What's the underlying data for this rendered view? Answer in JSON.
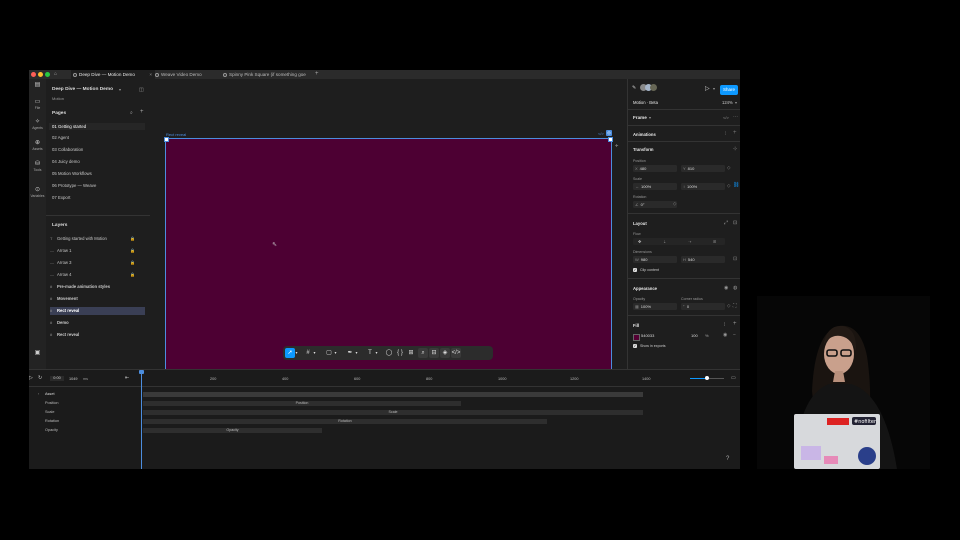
{
  "tabs": [
    {
      "label": "Deep Dive — Motion Demo",
      "active": true
    },
    {
      "label": "Weave Video Demo",
      "active": false
    },
    {
      "label": "Spinny Pink Square (if something goe",
      "active": false
    }
  ],
  "new_tab_symbol": "+",
  "file": {
    "name": "Deep Dive — Motion Demo",
    "subtitle": "Motion"
  },
  "rail": [
    {
      "icon": "file-icon",
      "label": "File"
    },
    {
      "icon": "agents-icon",
      "label": "Agents"
    },
    {
      "icon": "assets-icon",
      "label": "Assets"
    },
    {
      "icon": "tools-icon",
      "label": "Tools"
    },
    {
      "icon": "variables-icon",
      "label": "Variables"
    }
  ],
  "pages": {
    "title": "Pages",
    "items": [
      "01 Getting started",
      "02 Agent",
      "03 Collaboration",
      "04 Juicy demo",
      "05 Motion Workflows",
      "06 Prototype — Weave",
      "07 Export"
    ],
    "selected_index": 0
  },
  "layers": {
    "title": "Layers",
    "items": [
      {
        "label": "Getting started with Motion",
        "locked": true,
        "bold": false
      },
      {
        "label": "Arrow 1",
        "locked": true,
        "bold": false
      },
      {
        "label": "Arrow 3",
        "locked": true,
        "bold": false
      },
      {
        "label": "Arrow 4",
        "locked": true,
        "bold": false
      },
      {
        "label": "Pre-made animation styles",
        "locked": false,
        "bold": true
      },
      {
        "label": "Movement",
        "locked": false,
        "bold": true
      },
      {
        "label": "Rect reveal",
        "locked": false,
        "bold": true
      },
      {
        "label": "Demo",
        "locked": false,
        "bold": true
      },
      {
        "label": "Rect reveal",
        "locked": false,
        "bold": true
      }
    ],
    "selected_index": 6
  },
  "canvas": {
    "frame_label": "Rect reveal",
    "frame_color": "#4d0033"
  },
  "right": {
    "mode": "Motion · Beta",
    "zoom": "124%",
    "share": "Share",
    "frame_label": "Frame",
    "animations": "Animations",
    "transform": "Transform",
    "position_label": "Position",
    "x": "480",
    "y": "810",
    "scale_label": "Scale",
    "scale_x": "100%",
    "scale_y": "100%",
    "rotation_label": "Rotation",
    "rotation": "0°",
    "layout": "Layout",
    "flow_label": "Flow",
    "dimensions_label": "Dimensions",
    "w": "980",
    "h": "540",
    "clip_content": "Clip content",
    "appearance": "Appearance",
    "opacity_label": "Opacity",
    "opacity": "100%",
    "radius_label": "Corner radius",
    "radius": "0",
    "fill": "Fill",
    "fill_hex": "540033",
    "fill_opacity": "100",
    "fill_pct": "%",
    "show_in_exports": "Show in exports"
  },
  "timeline": {
    "time_a": "0:00",
    "time_b": "1049",
    "unit": "ms",
    "ticks": [
      "200",
      "400",
      "600",
      "800",
      "1000",
      "1200",
      "1400"
    ],
    "tracks": [
      {
        "label": "Asset",
        "bar": ""
      },
      {
        "label": "Position",
        "bar": "Position"
      },
      {
        "label": "Scale",
        "bar": "Scale"
      },
      {
        "label": "Rotation",
        "bar": "Rotation"
      },
      {
        "label": "Opacity",
        "bar": "Opacity"
      }
    ],
    "help": "?"
  },
  "webcam_sticker_text": "#nofilter"
}
